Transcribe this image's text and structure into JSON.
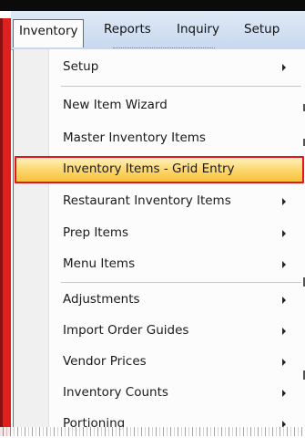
{
  "menubar": {
    "items": [
      "Inventory",
      "Reports",
      "Inquiry",
      "Setup"
    ]
  },
  "dropdown": {
    "items": [
      {
        "label": "Setup",
        "has_submenu": true
      },
      {
        "label": "New Item Wizard",
        "has_submenu": false
      },
      {
        "label": "Master Inventory Items",
        "has_submenu": false
      },
      {
        "label": "Inventory Items - Grid Entry",
        "has_submenu": false,
        "highlighted": true
      },
      {
        "label": "Restaurant Inventory Items",
        "has_submenu": true
      },
      {
        "label": "Prep Items",
        "has_submenu": true
      },
      {
        "label": "Menu Items",
        "has_submenu": true
      },
      {
        "label": "Adjustments",
        "has_submenu": true
      },
      {
        "label": "Import Order Guides",
        "has_submenu": true
      },
      {
        "label": "Vendor Prices",
        "has_submenu": true
      },
      {
        "label": "Inventory Counts",
        "has_submenu": true
      },
      {
        "label": "Portioning",
        "has_submenu": true
      }
    ]
  },
  "colors": {
    "highlight_fill": "#fcd770",
    "highlight_border": "#e4161c",
    "menubar_bg": "#c7d8ee",
    "left_strip": "#e0201e"
  },
  "icons": {
    "submenu_arrow": "chevron-right-icon"
  }
}
